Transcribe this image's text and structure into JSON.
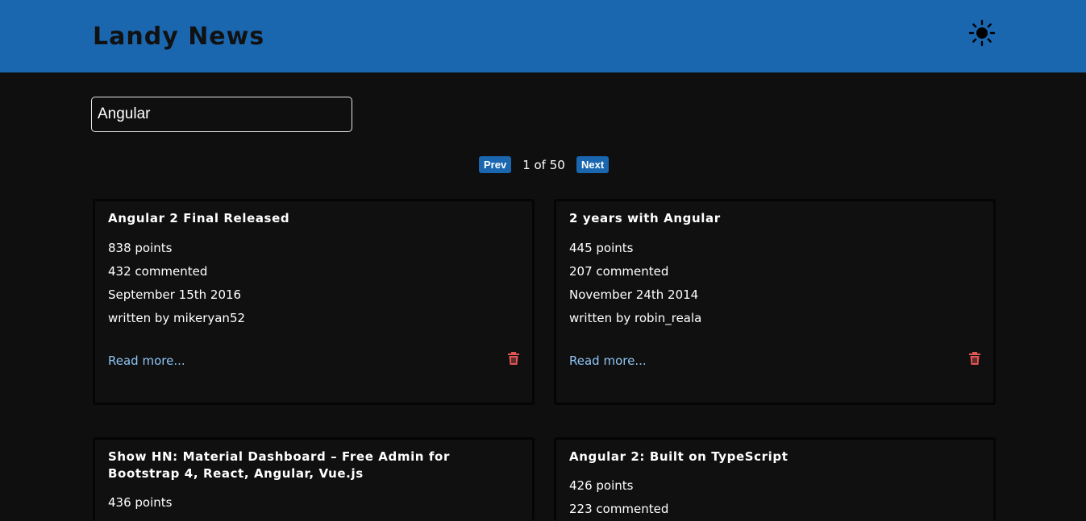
{
  "header": {
    "brand": "Landy News",
    "theme_icon": "sun-icon"
  },
  "search": {
    "value": "Angular",
    "placeholder": ""
  },
  "pagination": {
    "prev_label": "Prev",
    "page_info": "1 of 50",
    "next_label": "Next"
  },
  "stories": [
    {
      "title": "Angular 2 Final Released",
      "points": "838 points",
      "comments": "432 commented",
      "date": "September 15th 2016",
      "author": "written by mikeryan52",
      "read_more": "Read more...",
      "delete_icon": "trash-icon"
    },
    {
      "title": "2 years with Angular",
      "points": "445 points",
      "comments": "207 commented",
      "date": "November 24th 2014",
      "author": "written by robin_reala",
      "read_more": "Read more...",
      "delete_icon": "trash-icon"
    },
    {
      "title": "Show HN: Material Dashboard – Free Admin for Bootstrap 4, React, Angular, Vue.js",
      "points": "436 points"
    },
    {
      "title": "Angular 2: Built on TypeScript",
      "points": "426 points",
      "comments": "223 commented"
    }
  ],
  "colors": {
    "header_bg": "#1a67b0",
    "page_bg": "#0f0f0f",
    "card_bg": "#101010",
    "link": "#8ec5f5",
    "delete": "#e25555",
    "button_bg": "#1a67b0"
  }
}
